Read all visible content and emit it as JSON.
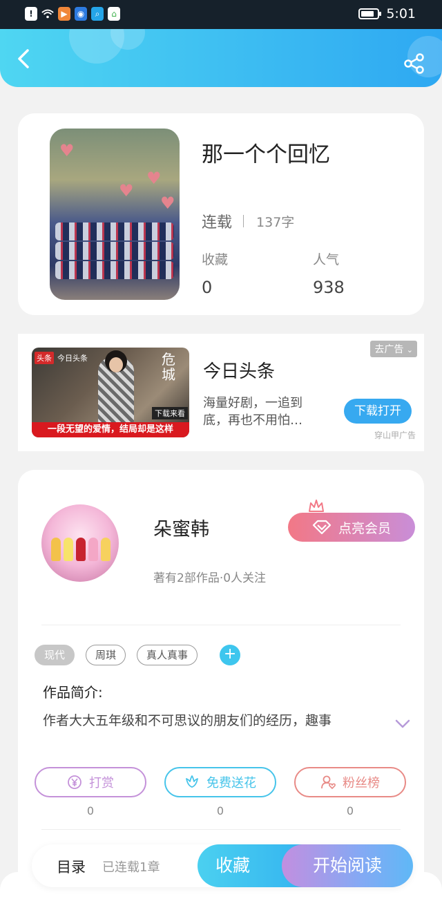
{
  "status_bar": {
    "time": "5:01"
  },
  "book": {
    "title": "那一个个回忆",
    "status": "连载",
    "word_count": "137字",
    "favorites_label": "收藏",
    "favorites_value": "0",
    "popularity_label": "人气",
    "popularity_value": "938"
  },
  "ad": {
    "title": "今日头条",
    "description": "海量好剧，一追到底，再也不用怕…",
    "close_label": "去广告",
    "cta_label": "下载打开",
    "source": "穿山甲广告",
    "image_tag_badge": "头条",
    "image_tag_text": "今日头条",
    "image_vertical_text": "危城",
    "image_download_text": "下载来看",
    "image_caption": "一段无望的爱情，结局却是这样"
  },
  "author": {
    "name": "朵蜜韩",
    "meta": "著有2部作品·0人关注",
    "vip_label": "点亮会员"
  },
  "tags": [
    "现代",
    "周琪",
    "真人真事"
  ],
  "intro": {
    "heading": "作品简介:",
    "text": "作者大大五年级和不可思议的朋友们的经历，趣事"
  },
  "actions": [
    {
      "label": "打赏",
      "count": "0",
      "color": "#c491d9"
    },
    {
      "label": "免费送花",
      "count": "0",
      "color": "#46c4ea"
    },
    {
      "label": "粉丝榜",
      "count": "0",
      "color": "#e88a86"
    }
  ],
  "bottom_bar": {
    "toc_label": "目录",
    "toc_sub": "已连载1章",
    "favorite_label": "收藏",
    "read_label": "开始阅读"
  },
  "colors": {
    "accent": "#2ea8f2",
    "accent_light": "#4fd6f2",
    "vip_start": "#f27886",
    "vip_end": "#c98ed8"
  }
}
